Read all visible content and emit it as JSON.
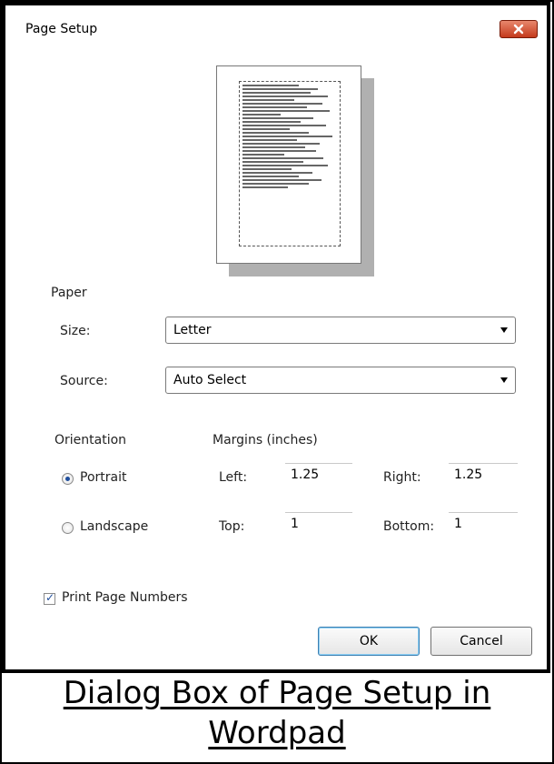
{
  "dialog": {
    "title": "Page Setup",
    "close_icon": "close-icon"
  },
  "paper": {
    "group_label": "Paper",
    "size_label": "Size:",
    "size_value": "Letter",
    "source_label": "Source:",
    "source_value": "Auto Select"
  },
  "orientation": {
    "group_label": "Orientation",
    "portrait_label": "Portrait",
    "landscape_label": "Landscape",
    "selected": "Portrait"
  },
  "margins": {
    "group_label": "Margins (inches)",
    "left_label": "Left:",
    "left_value": "1.25",
    "right_label": "Right:",
    "right_value": "1.25",
    "top_label": "Top:",
    "top_value": "1",
    "bottom_label": "Bottom:",
    "bottom_value": "1"
  },
  "options": {
    "print_page_numbers_label": "Print Page Numbers",
    "print_page_numbers_checked": true
  },
  "buttons": {
    "ok_label": "OK",
    "cancel_label": "Cancel"
  },
  "caption": {
    "line1": "Dialog Box of Page Setup in",
    "line2": "Wordpad"
  },
  "colors": {
    "close_button": "#c43a1c",
    "accent_blue": "#1f4e9c"
  }
}
